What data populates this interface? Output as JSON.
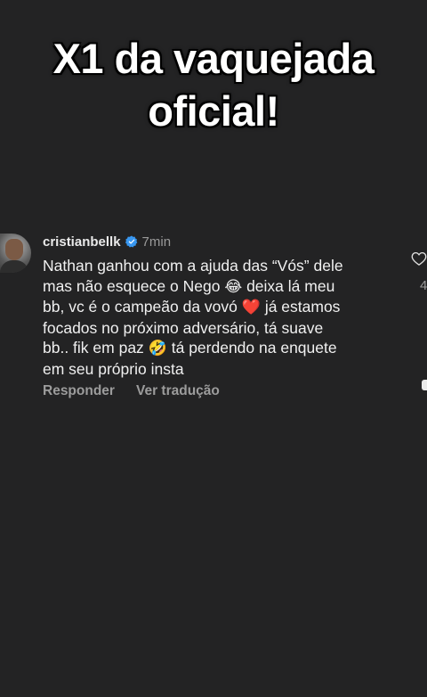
{
  "headline": {
    "line1": "X1 da vaquejada",
    "line2": "oficial!"
  },
  "comment": {
    "username": "cristianbellk",
    "verified_badge": "verified-icon",
    "time": "7min",
    "body_lines": [
      "Nathan ganhou com a ajuda das “Vós” dele",
      "mas não esquece o Nego",
      "deixa lá meu",
      "bb, vc é o campeão da vovó",
      "já estamos",
      "focados no próximo adversário, tá suave",
      "bb.. fik em paz",
      "tá perdendo na enquete",
      "em seu próprio insta"
    ],
    "emojis": {
      "laugh": "😂",
      "heart": "❤️",
      "rofl": "🤣"
    },
    "actions": {
      "reply": "Responder",
      "translate": "Ver tradução"
    },
    "like_count": "4",
    "like_icon": "heart-outline-icon"
  },
  "colors": {
    "background": "#232324",
    "text": "#f0f0f0",
    "secondary": "#9c9c9c",
    "verified": "#3897f0"
  }
}
